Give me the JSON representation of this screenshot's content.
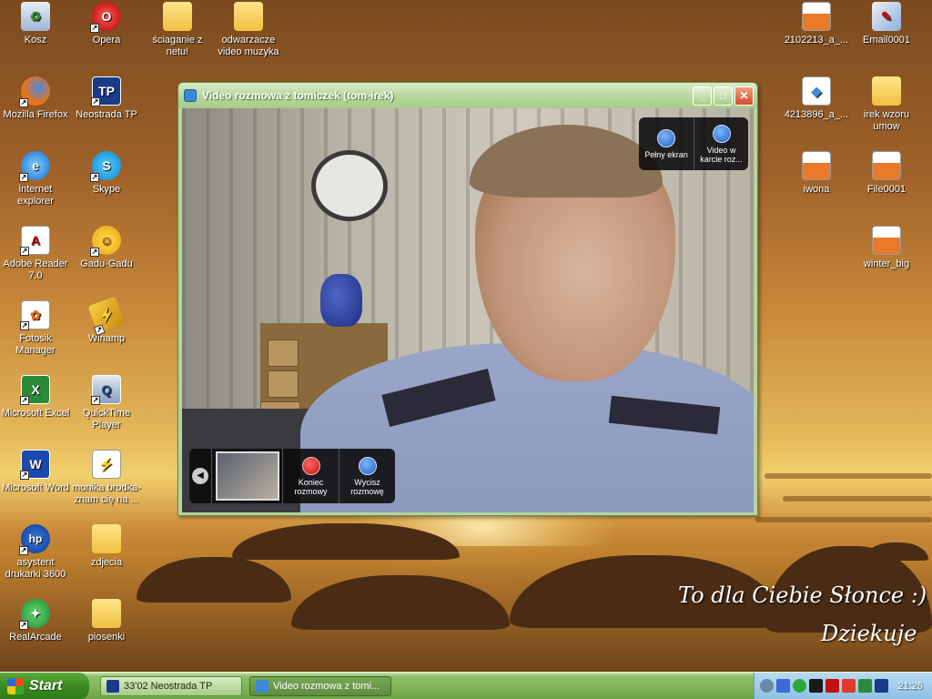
{
  "window": {
    "title": "Video rozmowa z tomiczek (tom-irek)",
    "fullscreen_label": "Pełny ekran",
    "video_tab_label": "Video w karcie roz...",
    "end_call_label": "Koniec rozmowy",
    "mute_label": "Wycisz rozmowę"
  },
  "desktop": {
    "icons": [
      {
        "label": "Kosz"
      },
      {
        "label": "Opera"
      },
      {
        "label": "ściaganie z netu!"
      },
      {
        "label": "odwarzacze video muzyka"
      },
      {
        "label": "Mozilla Firefox"
      },
      {
        "label": "Neostrada TP"
      },
      {
        "label": "internet explorer"
      },
      {
        "label": "Skype"
      },
      {
        "label": "Adobe Reader 7.0"
      },
      {
        "label": "Gadu-Gadu"
      },
      {
        "label": "Fotosik Manager"
      },
      {
        "label": "Winamp"
      },
      {
        "label": "Microsoft Excel"
      },
      {
        "label": "QuickTime Player"
      },
      {
        "label": "Microsoft Word"
      },
      {
        "label": "monika brodka-znam cię na ..."
      },
      {
        "label": "asystent drukarki 3600"
      },
      {
        "label": "zdjecia"
      },
      {
        "label": "RealArcade"
      },
      {
        "label": "piosenki"
      },
      {
        "label": "2102213_a_..."
      },
      {
        "label": "Email0001"
      },
      {
        "label": "4213896_a_..."
      },
      {
        "label": "irek wzoru umow"
      },
      {
        "label": "iwona"
      },
      {
        "label": "File0001"
      },
      {
        "label": "winter_big"
      }
    ]
  },
  "wallpaper": {
    "line1": "To dla Ciebie Słonce :)",
    "line2": "Dziekuje"
  },
  "taskbar": {
    "start_label": "Start",
    "tasks": [
      {
        "label": "33'02 Neostrada TP"
      },
      {
        "label": "Video rozmowa z tomi..."
      }
    ],
    "clock": "21:26"
  },
  "colors": {
    "window_frame": "#b5d39a",
    "taskbar": "#7fb456",
    "tray": "#8ec0e4",
    "end_call": "#c41010"
  }
}
